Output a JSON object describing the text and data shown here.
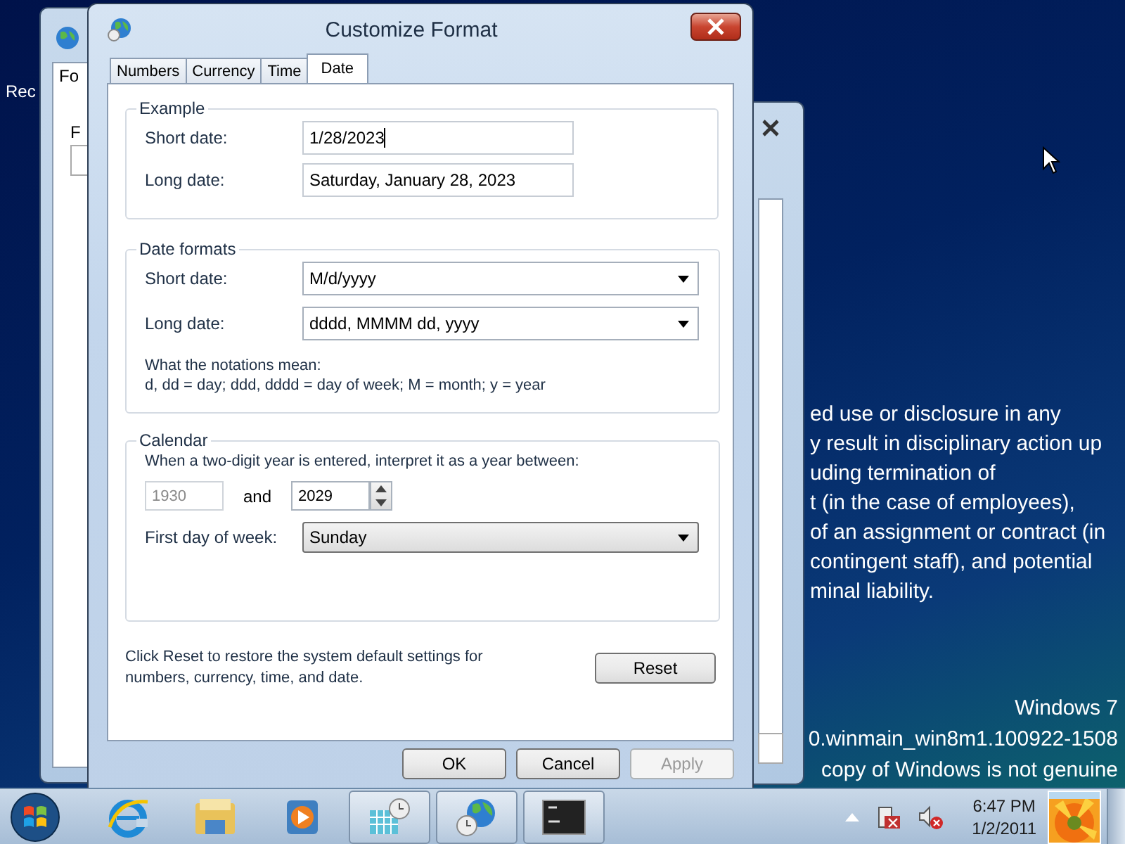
{
  "desktop": {
    "icon_label": "Rec",
    "notice_lines": [
      "ed use or disclosure in any",
      "y result in disciplinary action up",
      "uding termination of",
      "t (in the case of employees),",
      "of an assignment or contract (in",
      "contingent staff), and potential",
      "minal liability."
    ],
    "watermark_lines": [
      "Windows 7",
      "0.winmain_win8m1.100922-1508",
      "copy of Windows is not genuine"
    ]
  },
  "back_window": {
    "tab": "Fo",
    "label": "F"
  },
  "dialog": {
    "title": "Customize Format",
    "tabs": [
      {
        "label": "Numbers",
        "selected": false
      },
      {
        "label": "Currency",
        "selected": false
      },
      {
        "label": "Time",
        "selected": false
      },
      {
        "label": "Date",
        "selected": true
      }
    ],
    "example": {
      "title": "Example",
      "short_label": "Short date:",
      "short_value": "1/28/2023",
      "long_label": "Long date:",
      "long_value": "Saturday, January 28, 2023"
    },
    "date_formats": {
      "title": "Date formats",
      "short_label": "Short date:",
      "short_value": "M/d/yyyy",
      "long_label": "Long date:",
      "long_value": "dddd, MMMM dd, yyyy",
      "notations_title": "What the notations mean:",
      "notations": "d, dd = day;  ddd, dddd = day of week;  M = month;  y = year"
    },
    "calendar": {
      "title": "Calendar",
      "prompt": "When a two-digit year is entered, interpret it as a year between:",
      "from_year": "1930",
      "from_disabled": true,
      "and_text": "and",
      "to_year": "2029",
      "first_day_label": "First day of week:",
      "first_day": "Sunday"
    },
    "reset_note": "Click Reset to restore the system default settings for numbers, currency, time, and date.",
    "reset_button": "Reset",
    "buttons": [
      {
        "label": "OK",
        "disabled": false
      },
      {
        "label": "Cancel",
        "disabled": false
      },
      {
        "label": "Apply",
        "disabled": true
      }
    ]
  },
  "taskbar": {
    "items": [
      {
        "kind": "ie",
        "running": false
      },
      {
        "kind": "explorer",
        "running": false
      },
      {
        "kind": "media",
        "running": false
      },
      {
        "kind": "calendar",
        "running": true
      },
      {
        "kind": "globe",
        "running": true
      },
      {
        "kind": "cmd",
        "running": true
      }
    ],
    "clock": {
      "time": "6:47 PM",
      "date": "1/2/2011"
    }
  }
}
